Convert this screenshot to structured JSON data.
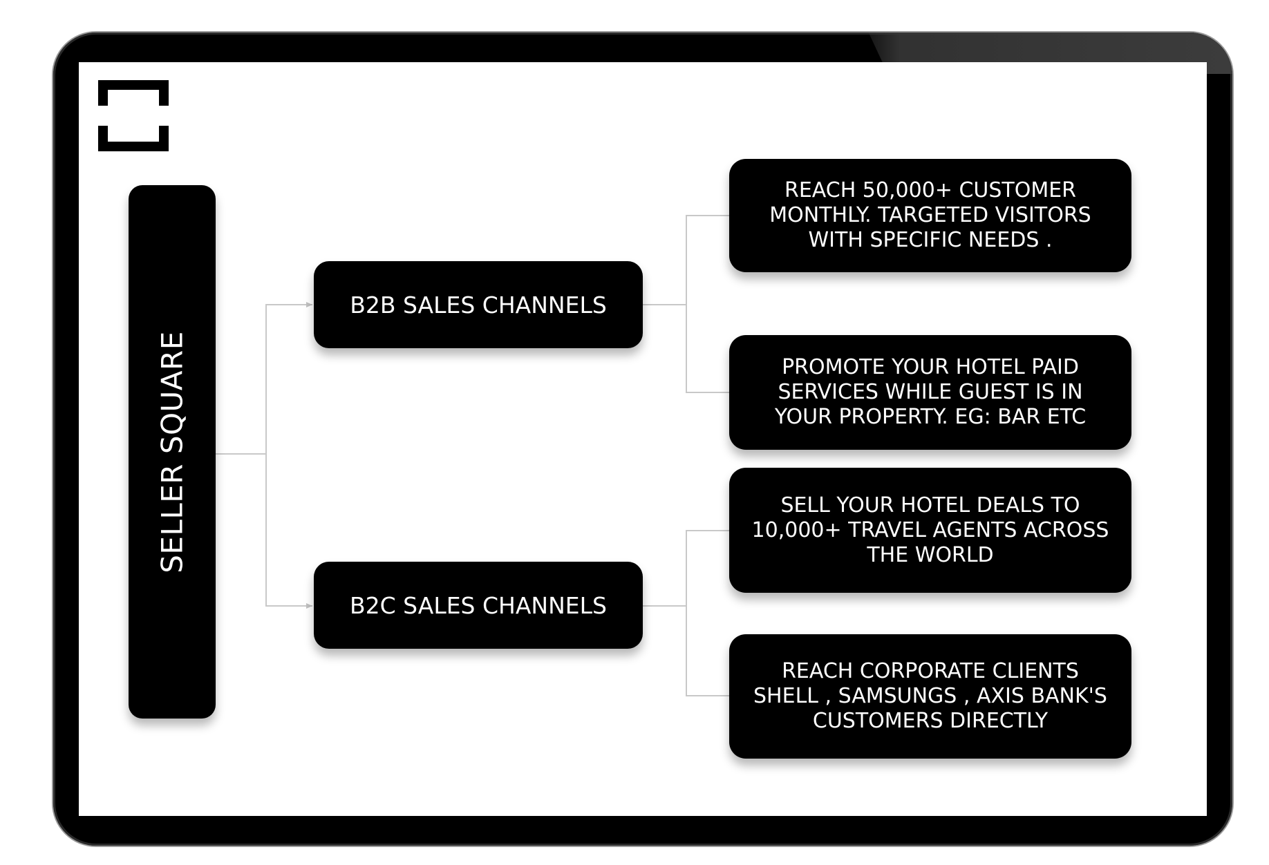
{
  "diagram": {
    "root": {
      "label": "SELLER SQUARE"
    },
    "channels": [
      {
        "label": "B2B SALES CHANNELS",
        "benefits": [
          "REACH 50,000+ CUSTOMER MONTHLY. TARGETED VISITORS WITH SPECIFIC NEEDS .",
          "PROMOTE YOUR HOTEL PAID SERVICES WHILE GUEST IS IN YOUR PROPERTY. EG: BAR ETC"
        ]
      },
      {
        "label": "B2C SALES CHANNELS",
        "benefits": [
          "SELL YOUR HOTEL DEALS TO 10,000+ TRAVEL AGENTS ACROSS THE WORLD",
          "REACH CORPORATE CLIENTS SHELL , SAMSUNGS , AXIS BANK'S CUSTOMERS DIRECTLY"
        ]
      }
    ]
  },
  "colors": {
    "node_fill": "#000000",
    "node_text": "#ffffff",
    "connector": "#c8c8c8",
    "device_frame": "#000000",
    "screen": "#ffffff"
  },
  "icons": {
    "logo": "bracket-square-logo-icon"
  }
}
